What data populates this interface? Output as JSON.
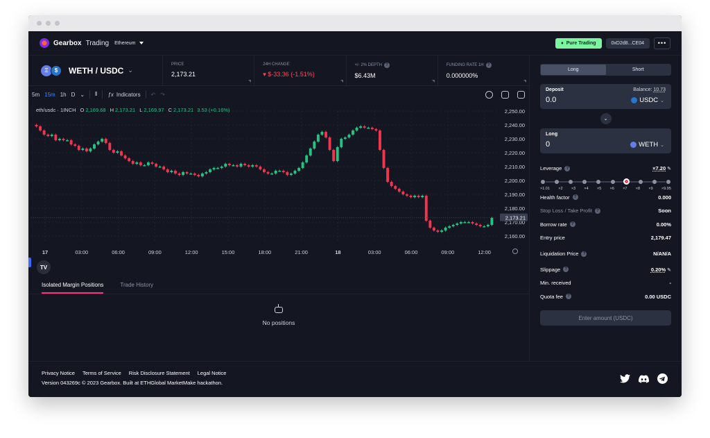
{
  "app": {
    "brand": "Gearbox",
    "brand_sub": "Trading",
    "network": "Ethereum"
  },
  "header": {
    "pure_trading": "Pure Trading",
    "address": "0xD2d8...CE04",
    "more": "•••"
  },
  "market": {
    "pair": "WETH / USDC",
    "stats": [
      {
        "label": "PRICE",
        "value": "2,173.21",
        "negative": false,
        "help": false
      },
      {
        "label": "24H CHANGE",
        "value": "▾ $-33.36 (-1.51%)",
        "negative": true,
        "help": false
      },
      {
        "label": "+/- 2% DEPTH",
        "value": "$6.43M",
        "negative": false,
        "help": true
      },
      {
        "label": "FUNDING RATE 1H",
        "value": "0.000000%",
        "negative": false,
        "help": true
      }
    ]
  },
  "toolbar": {
    "intervals": [
      "5m",
      "15m",
      "1h",
      "D"
    ],
    "active_interval": "15m",
    "indicators": "Indicators"
  },
  "ohlc": {
    "symbol": "eth/usdc · 1INCH",
    "o_label": "O",
    "o": "2,169.68",
    "h_label": "H",
    "h": "2,173.21",
    "l_label": "L",
    "l": "2,169.97",
    "c_label": "C",
    "c": "2,173.21",
    "change": "3.53 (+0.16%)"
  },
  "chart_data": {
    "type": "candlestick",
    "y_ticks": [
      "2,250.00",
      "2,240.00",
      "2,230.00",
      "2,220.00",
      "2,210.00",
      "2,200.00",
      "2,190.00",
      "2,180.00",
      "2,170.00",
      "2,160.00"
    ],
    "ylim": [
      2156,
      2250
    ],
    "x_ticks": [
      "17",
      "03:00",
      "06:00",
      "09:00",
      "12:00",
      "15:00",
      "18:00",
      "21:00",
      "18",
      "03:00",
      "06:00",
      "09:00",
      "12:00"
    ],
    "last_price": "2,173.21",
    "close_path": [
      2240,
      2239,
      2236,
      2233,
      2232,
      2233,
      2229,
      2230,
      2229,
      2229,
      2226,
      2225,
      2222,
      2223,
      2221,
      2223,
      2226,
      2228,
      2230,
      2227,
      2222,
      2220,
      2221,
      2218,
      2216,
      2214,
      2212,
      2213,
      2211,
      2211,
      2213,
      2212,
      2210,
      2210,
      2208,
      2206,
      2207,
      2205,
      2204,
      2206,
      2205,
      2205,
      2204,
      2203,
      2205,
      2206,
      2208,
      2209,
      2209,
      2210,
      2212,
      2211,
      2211,
      2210,
      2212,
      2211,
      2210,
      2211,
      2210,
      2208,
      2206,
      2205,
      2205,
      2207,
      2207,
      2206,
      2204,
      2205,
      2207,
      2209,
      2213,
      2218,
      2223,
      2228,
      2233,
      2235,
      2231,
      2222,
      2214,
      2224,
      2230,
      2231,
      2233,
      2236,
      2238,
      2239,
      2238,
      2238,
      2237,
      2236,
      2222,
      2209,
      2199,
      2196,
      2194,
      2192,
      2190,
      2189,
      2188,
      2189,
      2188,
      2189,
      2171,
      2166,
      2164,
      2163,
      2164,
      2166,
      2167,
      2168,
      2169,
      2170,
      2170,
      2170,
      2169,
      2168,
      2167,
      2167,
      2168,
      2173
    ]
  },
  "positions": {
    "tabs": [
      "Isolated Margin Positions",
      "Trade History"
    ],
    "empty": "No positions"
  },
  "trade": {
    "long": "Long",
    "short": "Short",
    "deposit_label": "Deposit",
    "balance_label": "Balance:",
    "balance": "10.73",
    "deposit_value": "0.0",
    "deposit_token": "USDC",
    "long_label": "Long",
    "long_value": "0",
    "long_token": "WETH",
    "leverage_label": "Leverage",
    "leverage_value": "×7.20",
    "leverage_marks": [
      "×1.01",
      "×2",
      "×3",
      "×4",
      "×5",
      "×6",
      "×7",
      "×8",
      "×9",
      "×9.95"
    ],
    "leverage_selected_index": 6,
    "health_label": "Health factor",
    "health": "0.000",
    "sltp_label": "Stop Loss / Take Profit",
    "sltp": "Soon",
    "borrow_label": "Borrow rate",
    "borrow": "0.00%",
    "entry_label": "Entry price",
    "entry": "2,179.47",
    "liq_label": "Liquidation Price",
    "liq": "N/A",
    "liq_sub": "N/A",
    "slippage_label": "Slippage",
    "slippage": "0.20%",
    "minrec_label": "Min. received",
    "minrec": "-",
    "quota_label": "Quota fee",
    "quota": "0.00 USDC",
    "enter": "Enter amount (USDC)"
  },
  "footer": {
    "links": [
      "Privacy Notice",
      "Terms of Service",
      "Risk Disclosure Statement",
      "Legal Notice"
    ],
    "version": "Version 043269c © 2023 Gearbox. Built at ETHGlobal MarketMake hackathon."
  },
  "colors": {
    "up": "#26c281",
    "down": "#f0354f",
    "accent": "#ff2f7a",
    "bg": "#141722"
  }
}
